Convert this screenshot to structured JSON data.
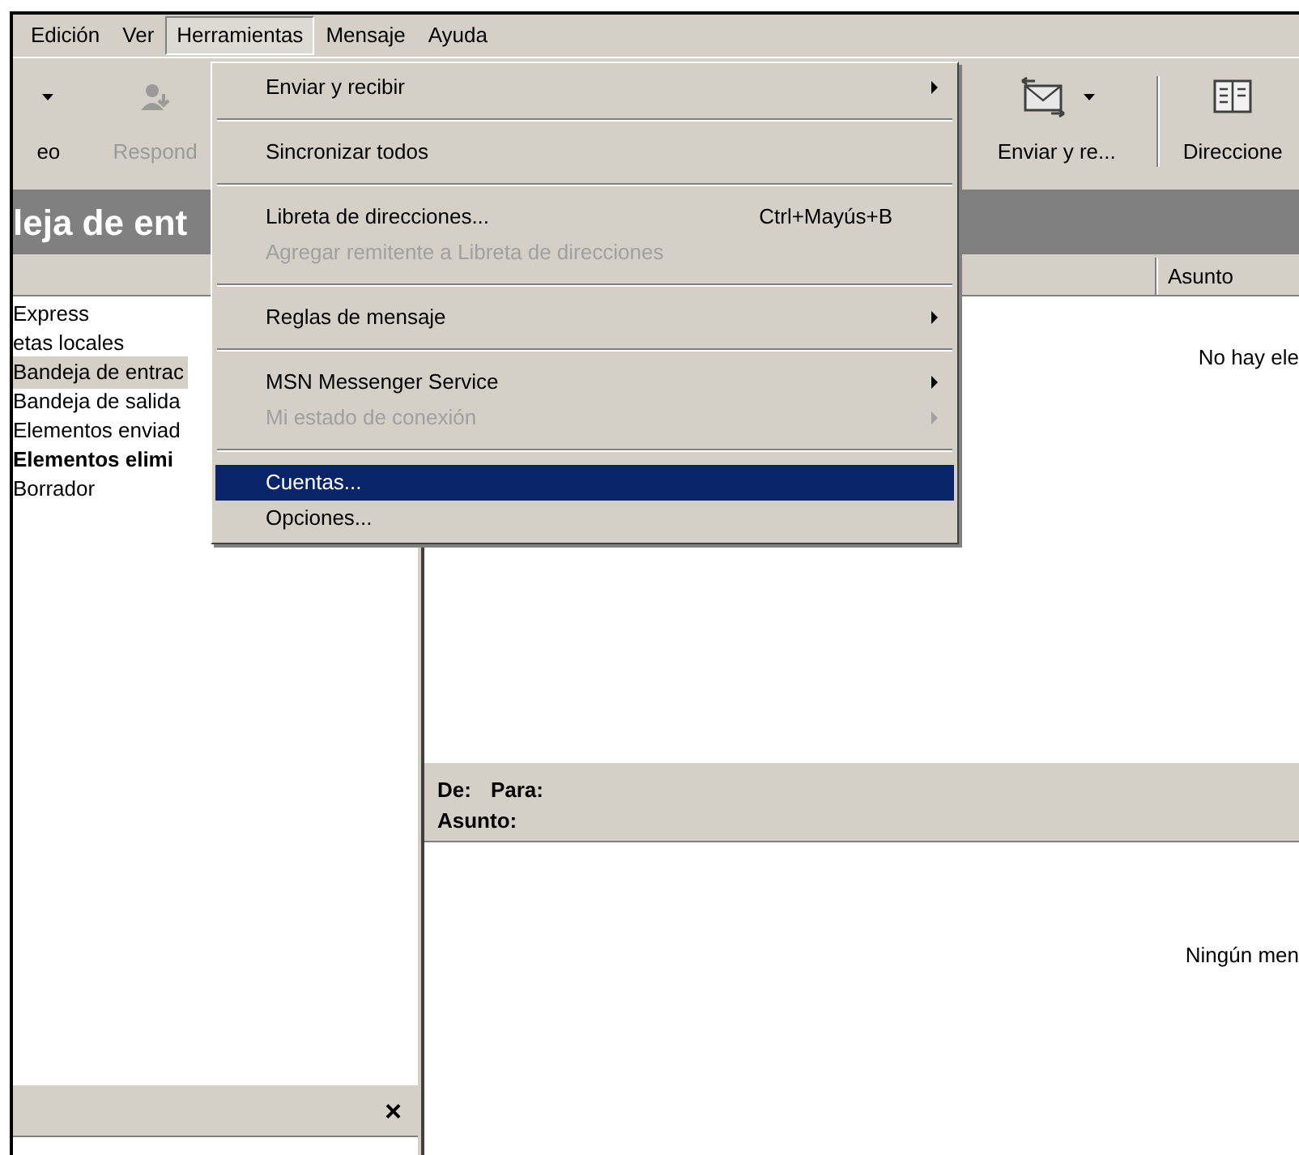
{
  "menu_bar": [
    {
      "label": "Edición",
      "selected": false
    },
    {
      "label": "Ver",
      "selected": false
    },
    {
      "label": "Herramientas",
      "selected": true
    },
    {
      "label": "Mensaje",
      "selected": false
    },
    {
      "label": "Ayuda",
      "selected": false
    }
  ],
  "toolbar": [
    {
      "kind": "new",
      "label": "eo",
      "disabled": false,
      "dropdown": true
    },
    {
      "kind": "reply",
      "label": "Respond",
      "disabled": true,
      "dropdown": false
    },
    {
      "kind": "send",
      "label": "Enviar y re...",
      "disabled": false,
      "dropdown": true
    },
    {
      "kind": "addresses",
      "label": "Direccione",
      "disabled": false,
      "dropdown": false
    }
  ],
  "folder_title": "leja de ent",
  "folders": [
    {
      "label": "Express",
      "selected": false,
      "unread": false
    },
    {
      "label": "etas locales",
      "selected": false,
      "unread": false
    },
    {
      "label": "Bandeja de entrac",
      "selected": true,
      "unread": false
    },
    {
      "label": "Bandeja de salida",
      "selected": false,
      "unread": false
    },
    {
      "label": "Elementos enviad",
      "selected": false,
      "unread": false
    },
    {
      "label": "Elementos elimi",
      "selected": false,
      "unread": true
    },
    {
      "label": "Borrador",
      "selected": false,
      "unread": false
    }
  ],
  "message_list": {
    "columns": [
      "Asunto"
    ],
    "empty_text": "No hay ele"
  },
  "preview": {
    "from_label": "De:",
    "to_label": "Para:",
    "subject_label": "Asunto:",
    "empty_text": "Ningún men"
  },
  "contacts_pane": {
    "close": "×"
  },
  "menu": {
    "groups": [
      [
        {
          "label": "Enviar y recibir",
          "submenu": true,
          "disabled": false,
          "selected": false
        }
      ],
      [
        {
          "label": "Sincronizar todos",
          "submenu": false,
          "disabled": false,
          "selected": false
        }
      ],
      [
        {
          "label": "Libreta de direcciones...",
          "shortcut": "Ctrl+Mayús+B",
          "submenu": false,
          "disabled": false,
          "selected": false
        },
        {
          "label": "Agregar remitente a Libreta de direcciones",
          "submenu": false,
          "disabled": true,
          "selected": false
        }
      ],
      [
        {
          "label": "Reglas de mensaje",
          "submenu": true,
          "disabled": false,
          "selected": false
        }
      ],
      [
        {
          "label": "MSN Messenger Service",
          "submenu": true,
          "disabled": false,
          "selected": false
        },
        {
          "label": "Mi estado de conexión",
          "submenu": true,
          "disabled": true,
          "selected": false
        }
      ],
      [
        {
          "label": "Cuentas...",
          "submenu": false,
          "disabled": false,
          "selected": true
        },
        {
          "label": "Opciones...",
          "submenu": false,
          "disabled": false,
          "selected": false
        }
      ]
    ]
  }
}
